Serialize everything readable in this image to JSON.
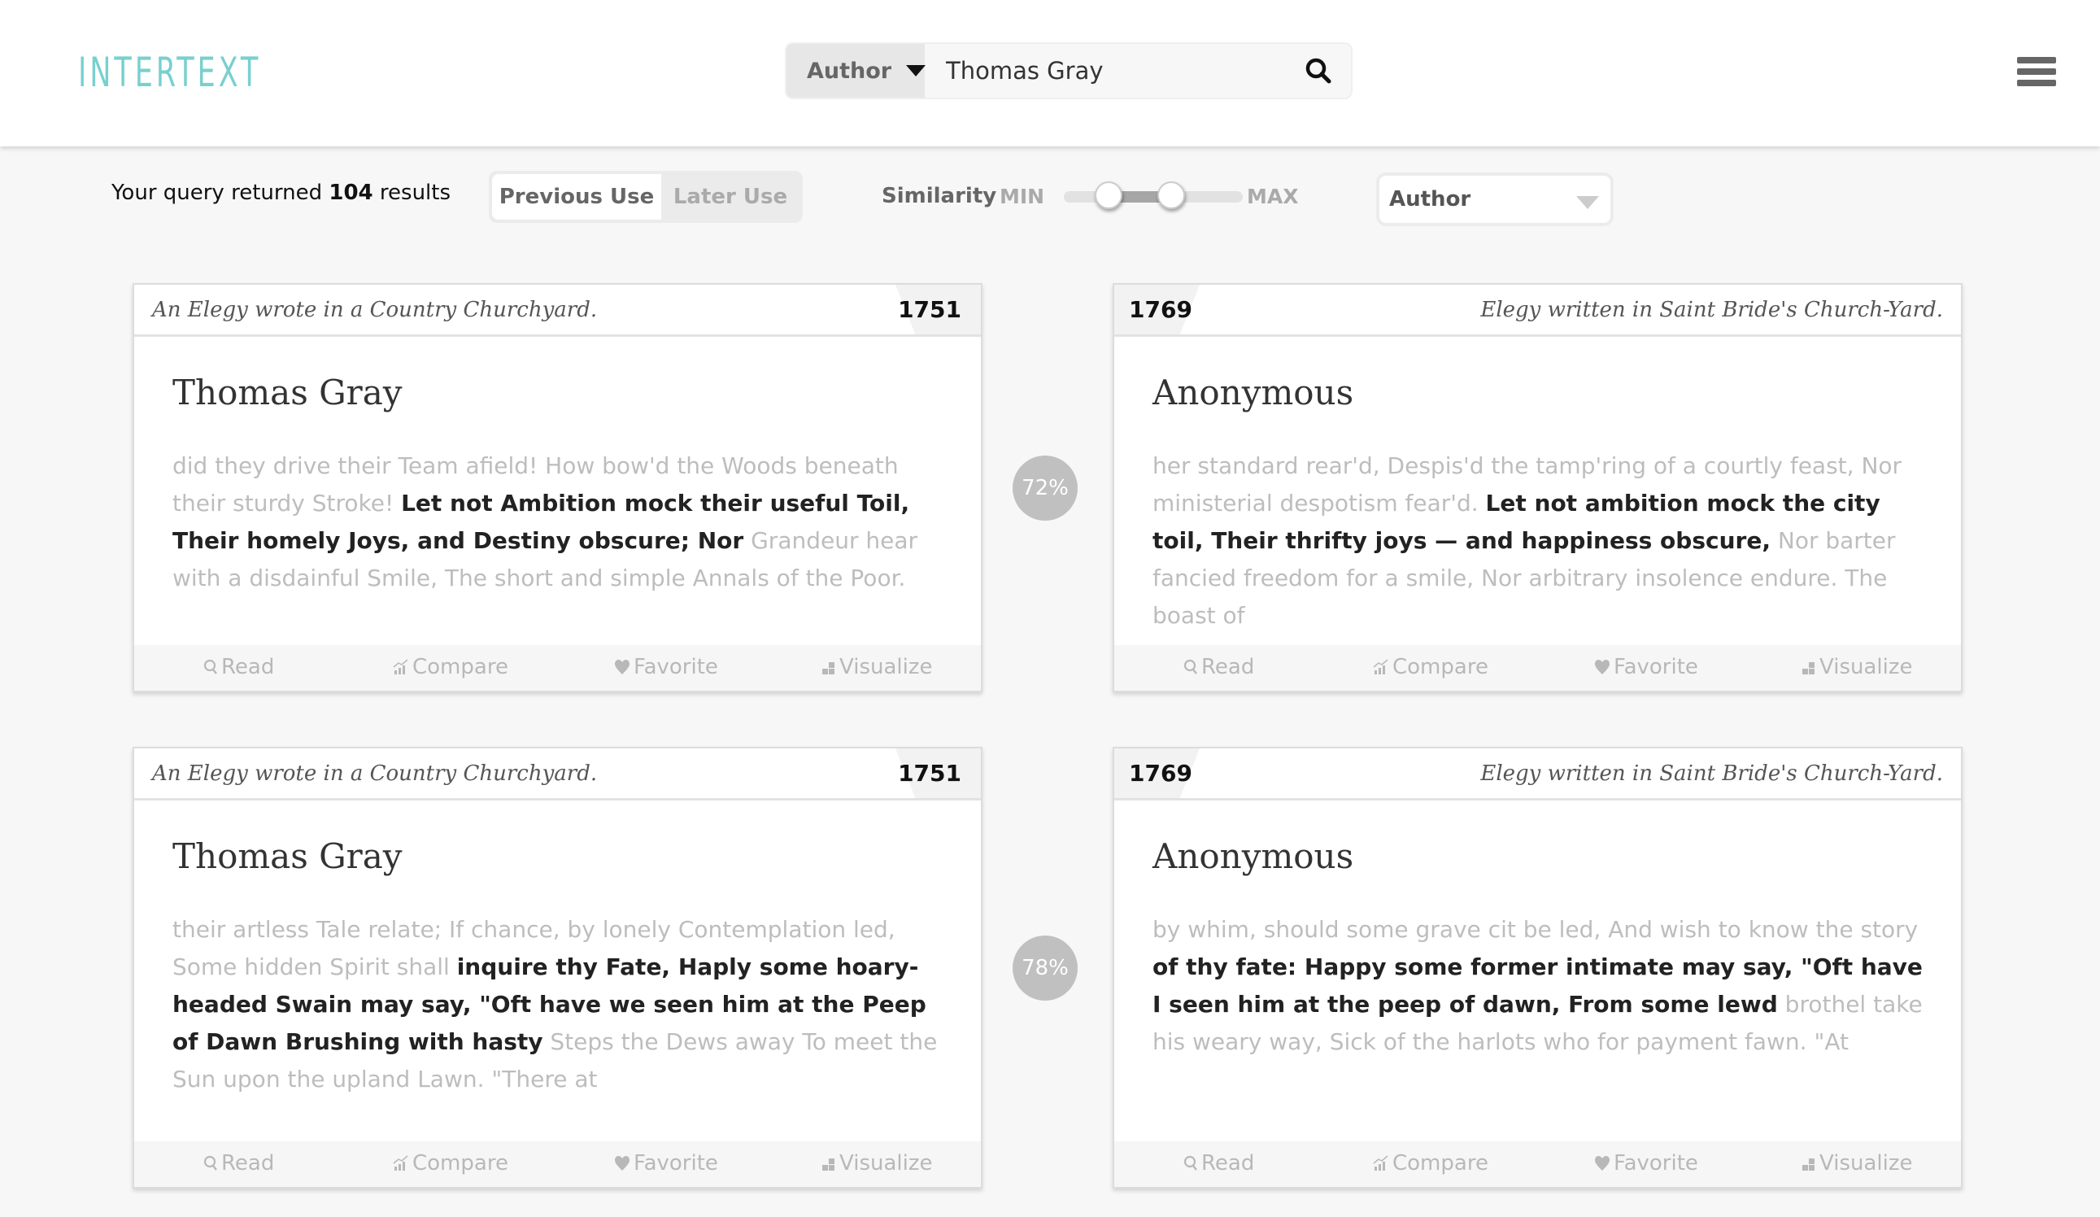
{
  "header": {
    "logo": "INTERTEXT",
    "search": {
      "type_label": "Author",
      "query": "Thomas Gray"
    }
  },
  "toolbar": {
    "results_prefix": "Your query returned",
    "results_count": "104",
    "results_suffix": "results",
    "tabs": [
      {
        "label": "Previous Use",
        "active": true
      },
      {
        "label": "Later Use",
        "active": false
      }
    ],
    "similarity_label": "Similarity",
    "min_label": "MIN",
    "max_label": "MAX",
    "similarity_range": {
      "low": 0.25,
      "high": 0.6
    },
    "sort_value": "Author"
  },
  "actions": {
    "read": "Read",
    "compare": "Compare",
    "favorite": "Favorite",
    "visualize": "Visualize"
  },
  "pairs": [
    {
      "similarity": "72%",
      "left": {
        "title": "An Elegy wrote in a Country Churchyard.",
        "year": "1751",
        "author": "Thomas Gray",
        "pre": "did they drive their Team afield! How bow'd the Woods beneath their sturdy Stroke! ",
        "match": "Let not Ambition mock their useful Toil, Their homely Joys, and Destiny obscure; Nor",
        "post": " Grandeur hear with a disdainful Smile, The short and simple Annals of the Poor."
      },
      "right": {
        "title": "Elegy written in Saint Bride's Church-Yard.",
        "year": "1769",
        "author": "Anonymous",
        "pre": "her standard rear'd, Despis'd the tamp'ring of a courtly feast, Nor ministerial despotism fear'd. ",
        "match": "Let not ambition mock the city toil, Their thrifty joys — and happiness obscure,",
        "post": " Nor barter fancied freedom for a smile, Nor arbitrary insolence endure. The boast of"
      }
    },
    {
      "similarity": "78%",
      "left": {
        "title": "An Elegy wrote in a Country Churchyard.",
        "year": "1751",
        "author": "Thomas Gray",
        "pre": "their artless Tale relate; If chance, by lonely Contemplation led, Some hidden Spirit shall ",
        "match": "inquire thy Fate, Haply some hoary-headed Swain may say, \"Oft have we seen him at the Peep of Dawn Brushing with hasty",
        "post": " Steps the Dews away To meet the Sun upon the upland Lawn. \"There at"
      },
      "right": {
        "title": "Elegy written in Saint Bride's Church-Yard.",
        "year": "1769",
        "author": "Anonymous",
        "pre": "by whim, should some grave cit be led, And wish to know the story ",
        "match": "of thy fate: Happy some former intimate may say, \"Oft have I seen him at the peep of dawn, From some lewd",
        "post": " brothel take his weary way, Sick of the harlots who for payment fawn. \"At"
      }
    }
  ]
}
